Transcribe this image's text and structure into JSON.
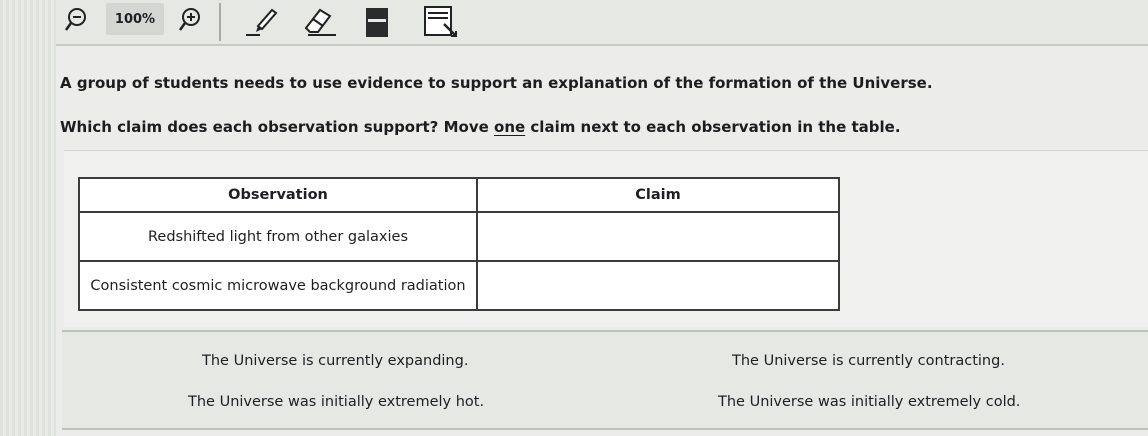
{
  "toolbar": {
    "zoom_level": "100%",
    "tools": [
      {
        "icon": "zoom-out-icon"
      },
      {
        "icon": "zoom-in-icon"
      },
      {
        "icon": "pencil-icon"
      },
      {
        "icon": "eraser-icon"
      },
      {
        "icon": "notepad-icon"
      },
      {
        "icon": "line-reader-icon"
      }
    ]
  },
  "question": {
    "line1": "A group of students needs to use evidence to support an explanation of the formation of the Universe.",
    "line2_before": "Which claim does each observation support? Move ",
    "line2_emph": "one",
    "line2_after": " claim next to each observation in the table."
  },
  "table": {
    "headers": {
      "observation": "Observation",
      "claim": "Claim"
    },
    "rows": [
      {
        "observation": "Redshifted light from other galaxies",
        "claim": ""
      },
      {
        "observation": "Consistent cosmic microwave background radiation",
        "claim": ""
      }
    ]
  },
  "claim_bank": {
    "items": [
      "The Universe is currently expanding.",
      "The Universe is currently contracting.",
      "The Universe was initially extremely hot.",
      "The Universe was initially extremely cold."
    ]
  },
  "colors": {
    "background": "#e8eae6",
    "table_border": "#3a3c3e",
    "text": "#1d1f22"
  }
}
